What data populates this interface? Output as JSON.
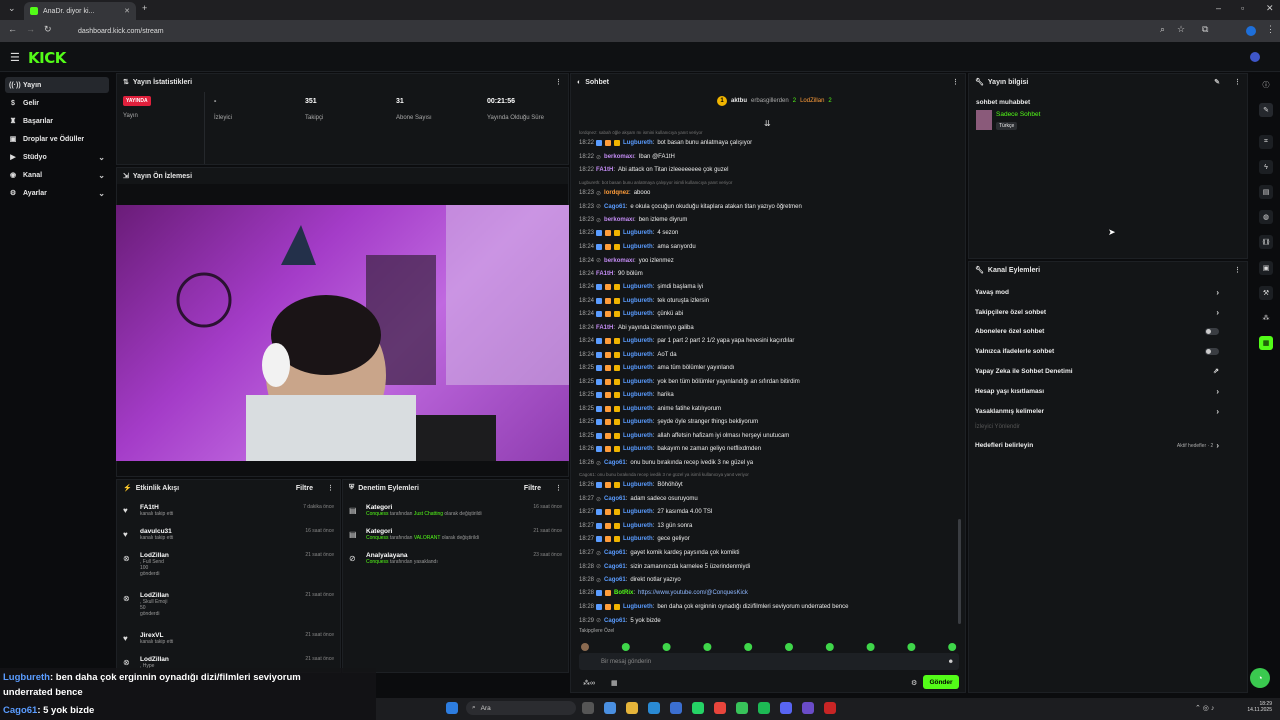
{
  "browser": {
    "tab_title": "AnaDr. diyor ki...",
    "url": "dashboard.kick.com/stream"
  },
  "logo": "KICK",
  "sidebar": {
    "items": [
      {
        "label": "Yayın",
        "icon": "broadcast-icon",
        "active": true
      },
      {
        "label": "Gelir",
        "icon": "money-icon"
      },
      {
        "label": "Başarılar",
        "icon": "trophy-icon"
      },
      {
        "label": "Droplar ve Ödüller",
        "icon": "gift-icon"
      },
      {
        "label": "Stüdyo",
        "icon": "studio-icon",
        "chevron": true
      },
      {
        "label": "Kanal",
        "icon": "channel-icon",
        "chevron": true
      },
      {
        "label": "Ayarlar",
        "icon": "settings-icon",
        "chevron": true
      }
    ]
  },
  "stats": {
    "title": "Yayın İstatistikleri",
    "live_badge": "YAYINDA",
    "items": [
      {
        "value": "",
        "label": "Yayın"
      },
      {
        "value": "-",
        "label": "İzleyici"
      },
      {
        "value": "351",
        "label": "Takipçi"
      },
      {
        "value": "31",
        "label": "Abone Sayısı"
      },
      {
        "value": "00:21:56",
        "label": "Yayında Olduğu Süre"
      }
    ]
  },
  "preview": {
    "title": "Yayın Ön İzlemesi"
  },
  "activity": {
    "title": "Etkinlik Akışı",
    "filter": "Filtre",
    "items": [
      {
        "name": "FA1tH",
        "sub": "kanalı takip etti",
        "time": "7 dakika önce",
        "icon": "heart-icon"
      },
      {
        "name": "davulcu31",
        "sub": "kanalı takip etti",
        "time": "16 saat önce",
        "icon": "heart-icon"
      },
      {
        "name": "LodZillan",
        "sub": ", Full Send",
        "extra": "100",
        "extra2": "gönderdi",
        "time": "21 saat önce",
        "icon": "kick-icon"
      },
      {
        "name": "LodZillan",
        "sub": ", Skull Emoji",
        "extra": "50",
        "extra2": "gönderdi",
        "time": "21 saat önce",
        "icon": "kick-icon"
      },
      {
        "name": "JirexVL",
        "sub": "kanalı takip etti",
        "time": "21 saat önce",
        "icon": "heart-icon"
      },
      {
        "name": "LodZillan",
        "sub": ", Hype",
        "time": "21 saat önce",
        "icon": "kick-icon"
      }
    ]
  },
  "moderation": {
    "title": "Denetim Eylemleri",
    "filter": "Filtre",
    "items": [
      {
        "name": "Kategori",
        "actor": "Conquess",
        "mid": "tarafından",
        "target": "Just Chatting",
        "end": "olarak değiştirildi",
        "time": "16 saat önce"
      },
      {
        "name": "Kategori",
        "actor": "Conquess",
        "mid": "tarafından",
        "target": "VALORANT",
        "end": "olarak değiştirildi",
        "time": "21 saat önce"
      },
      {
        "name": "Analyalayana",
        "actor": "Conquess",
        "mid": "tarafından yasaklandı",
        "target": "",
        "end": "",
        "time": "23 saat önce"
      }
    ]
  },
  "chat": {
    "title": "Sohbet",
    "top": {
      "user1": "aktbu",
      "n1": "1",
      "user2": "erbasgillerden",
      "n2": "2",
      "user3": "LodZillan",
      "n3": "2"
    },
    "messages": [
      {
        "reply": "lordqnez: sabah öğle akşam mı ismini kullanıcıya yanıt veriyor"
      },
      {
        "time": "18:22",
        "user": "Lugbureth",
        "text": "bot basan bunu anlatmaya çalışıyor",
        "color": "#5a9cff",
        "badges": 3
      },
      {
        "time": "18:22",
        "user": "berkomaxı",
        "text": "Iban @FA1tH",
        "color": "#c48cf5",
        "badges": 1
      },
      {
        "time": "18:22",
        "user": "FA1tH",
        "text": "Abi attack on Titan izleeeeeeee çok guzel",
        "color": "#c48cf5",
        "badges": 0
      },
      {
        "reply": "Lugbureth: bot basan bunu anlatmaya çalışıyor isimli kullanıcıya yanıt veriyor"
      },
      {
        "time": "18:23",
        "user": "lordqnez",
        "text": "abooo",
        "color": "#ff9d3a",
        "badges": 1
      },
      {
        "time": "18:23",
        "user": "Cago61",
        "text": "e okula çocuğun okuduğu kitaplara atakan titan yazıyo öğretmen",
        "color": "#5a9cff",
        "badges": 1
      },
      {
        "time": "18:23",
        "user": "berkomaxı",
        "text": "ben izleme diyrum",
        "color": "#c48cf5",
        "badges": 1
      },
      {
        "time": "18:23",
        "user": "Lugbureth",
        "text": "4 sezon",
        "color": "#5a9cff",
        "badges": 3
      },
      {
        "time": "18:24",
        "user": "Lugbureth",
        "text": "ama sarıyordu",
        "color": "#5a9cff",
        "badges": 3
      },
      {
        "time": "18:24",
        "user": "berkomaxı",
        "text": "yoo izlenmez",
        "color": "#c48cf5",
        "badges": 1
      },
      {
        "time": "18:24",
        "user": "FA1tH",
        "text": "90 bölüm",
        "color": "#c48cf5",
        "badges": 0
      },
      {
        "time": "18:24",
        "user": "Lugbureth",
        "text": "şimdi başlama iyi",
        "color": "#5a9cff",
        "badges": 3
      },
      {
        "time": "18:24",
        "user": "Lugbureth",
        "text": "tek oturuşta izlersin",
        "color": "#5a9cff",
        "badges": 3
      },
      {
        "time": "18:24",
        "user": "Lugbureth",
        "text": "çünkü abi",
        "color": "#5a9cff",
        "badges": 3
      },
      {
        "time": "18:24",
        "user": "FA1tH",
        "text": "Abi yayında izlenmiyo galiba",
        "color": "#c48cf5",
        "badges": 0
      },
      {
        "time": "18:24",
        "user": "Lugbureth",
        "text": "par 1 part 2 part 2 1/2 yapa yapa hevesini kaçırdılar",
        "color": "#5a9cff",
        "badges": 3
      },
      {
        "time": "18:24",
        "user": "Lugbureth",
        "text": "AoT da",
        "color": "#5a9cff",
        "badges": 3
      },
      {
        "time": "18:25",
        "user": "Lugbureth",
        "text": "ama tüm bölümler yayınlandı",
        "color": "#5a9cff",
        "badges": 3
      },
      {
        "time": "18:25",
        "user": "Lugbureth",
        "text": "yok ben tüm bölümler yayınlandığı an sıfırdan bitirdim",
        "color": "#5a9cff",
        "badges": 3
      },
      {
        "time": "18:25",
        "user": "Lugbureth",
        "text": "harika",
        "color": "#5a9cff",
        "badges": 3
      },
      {
        "time": "18:25",
        "user": "Lugbureth",
        "text": "anime fatihe katılıyorum",
        "color": "#5a9cff",
        "badges": 3
      },
      {
        "time": "18:25",
        "user": "Lugbureth",
        "text": "şeyde öyle stranger things bekliyorum",
        "color": "#5a9cff",
        "badges": 3
      },
      {
        "time": "18:25",
        "user": "Lugbureth",
        "text": "allah affetsin hafizam iyi olması herşeyi unutucam",
        "color": "#5a9cff",
        "badges": 3
      },
      {
        "time": "18:26",
        "user": "Lugbureth",
        "text": "bakayım ne zaman geliyo netflixdmden",
        "color": "#5a9cff",
        "badges": 3
      },
      {
        "time": "18:26",
        "user": "Cago61",
        "text": "onu bunu bırakında recep ivedik 3 ne güzel ya",
        "color": "#5a9cff",
        "badges": 1
      },
      {
        "reply": "Cago61: onu bunu bırakında recep ivedik 3 ne güzel ya isimli kullanıcıya yanıt veriyor"
      },
      {
        "time": "18:26",
        "user": "Lugbureth",
        "text": "Böhöhöyt",
        "color": "#5a9cff",
        "badges": 3
      },
      {
        "time": "18:27",
        "user": "Cago61",
        "text": "adam sadece osuruyomu",
        "color": "#5a9cff",
        "badges": 1
      },
      {
        "time": "18:27",
        "user": "Lugbureth",
        "text": "27 kasımda 4.00 TSI",
        "color": "#5a9cff",
        "badges": 3
      },
      {
        "time": "18:27",
        "user": "Lugbureth",
        "text": "13 gün sonra",
        "color": "#5a9cff",
        "badges": 3
      },
      {
        "time": "18:27",
        "user": "Lugbureth",
        "text": "gece geliyor",
        "color": "#5a9cff",
        "badges": 3
      },
      {
        "time": "18:27",
        "user": "Cago61",
        "text": "gayet komik kardeş paysında çok komikti",
        "color": "#5a9cff",
        "badges": 1
      },
      {
        "time": "18:28",
        "user": "Cago61",
        "text": "sizin zamanınızda karnelee 5 üzerindenmiydi",
        "color": "#5a9cff",
        "badges": 1
      },
      {
        "time": "18:28",
        "user": "Cago61",
        "text": "direkt notlar yazıyo",
        "color": "#5a9cff",
        "badges": 1
      },
      {
        "time": "18:28",
        "user": "BotRix",
        "text": "https://www.youtube.com/@ConquesKick",
        "color": "#53fc18",
        "badges": 2
      },
      {
        "time": "18:28",
        "user": "Lugbureth",
        "text": "ben daha çok erginnin oynadığı dizi/filmleri seviyorum underrated bence",
        "color": "#5a9cff",
        "badges": 3
      },
      {
        "time": "18:29",
        "user": "Cago61",
        "text": "5 yok bizde",
        "color": "#5a9cff",
        "badges": 1
      }
    ],
    "followers_only": "Takipçilere Özel",
    "input_placeholder": "Bir mesaj gönderin",
    "send": "Gönder"
  },
  "stream_info": {
    "title": "Yayın bilgisi",
    "stream_title": "sohbet muhabbet",
    "category": "Sadece Sohbet",
    "language": "Türkçe"
  },
  "channel_actions": {
    "title": "Kanal Eylemleri",
    "items": [
      {
        "label": "Yavaş mod",
        "end": "chevron"
      },
      {
        "label": "Takipçilere özel sohbet",
        "end": "chevron"
      },
      {
        "label": "Abonelere özel sohbet",
        "end": "toggle"
      },
      {
        "label": "Yalnızca ifadelerle sohbet",
        "end": "toggle"
      },
      {
        "label": "Yapay Zeka ile Sohbet Denetimi",
        "end": "external"
      },
      {
        "label": "Hesap yaşı kısıtlaması",
        "end": "chevron"
      },
      {
        "label": "Yasaklanmış kelimeler",
        "end": "chevron"
      },
      {
        "label": "İzleyici Yönlendir",
        "end": "none",
        "disabled": true
      },
      {
        "label": "Hedefleri belirleyin",
        "end": "goals",
        "goal_text": "Aktif hedefler · 2"
      }
    ]
  },
  "overlay": {
    "line1_user": "Lugbureth",
    "line1_text": ": ben daha çok erginnin oynadığı dizi/filmleri seviyorum",
    "line2": "underrated bence",
    "line3_user": "Cago61",
    "line3_text": ": 5 yok bizde"
  },
  "taskbar": {
    "search": "Ara",
    "time": "18:29",
    "date": "14.11.2025"
  },
  "colors": {
    "accent": "#53fc18",
    "live": "#e0203c",
    "panel": "#131517"
  }
}
